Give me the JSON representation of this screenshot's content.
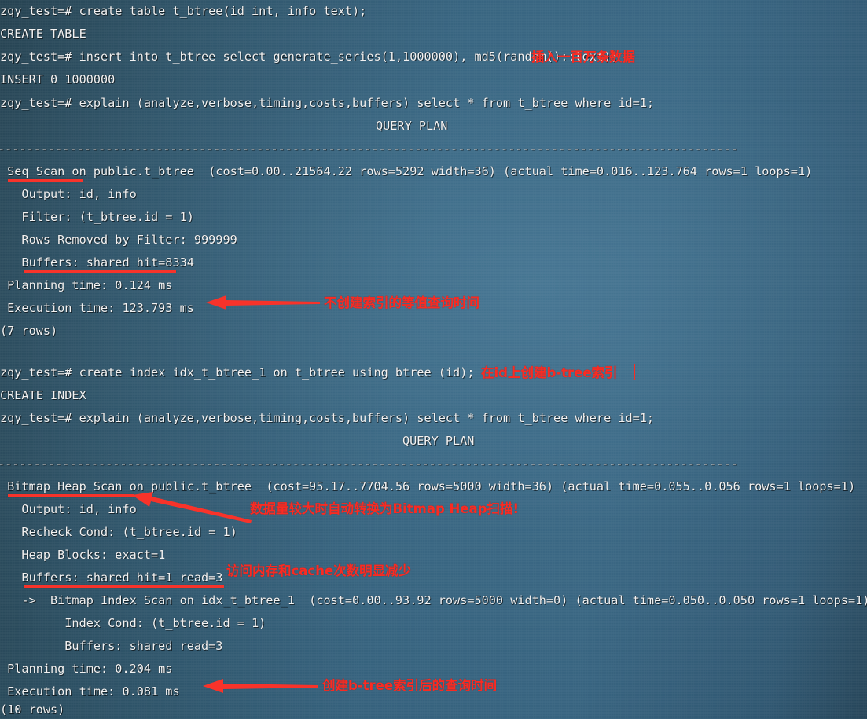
{
  "terminal": {
    "prompt": "zqy_test=#",
    "font_color": "#f2f2f2",
    "background_color": "#35617c",
    "annotation_color": "#fa2b22",
    "lines": [
      {
        "id": "l01",
        "text": "zqy_test=# create table t_btree(id int, info text);"
      },
      {
        "id": "l02",
        "text": "CREATE TABLE"
      },
      {
        "id": "l03",
        "text": "zqy_test=# insert into t_btree select generate_series(1,1000000), md5(random()::text);"
      },
      {
        "id": "l04",
        "text": "INSERT 0 1000000"
      },
      {
        "id": "l05",
        "text": "zqy_test=# explain (analyze,verbose,timing,costs,buffers) select * from t_btree where id=1;"
      },
      {
        "id": "l06",
        "text": "QUERY PLAN"
      },
      {
        "id": "l07",
        "text": "-------------------------------------------------------------------------------------------------------"
      },
      {
        "id": "l08",
        "text": " Seq Scan on public.t_btree  (cost=0.00..21564.22 rows=5292 width=36) (actual time=0.016..123.764 rows=1 loops=1)"
      },
      {
        "id": "l09",
        "text": "   Output: id, info"
      },
      {
        "id": "l10",
        "text": "   Filter: (t_btree.id = 1)"
      },
      {
        "id": "l11",
        "text": "   Rows Removed by Filter: 999999"
      },
      {
        "id": "l12",
        "text": "   Buffers: shared hit=8334"
      },
      {
        "id": "l13",
        "text": " Planning time: 0.124 ms"
      },
      {
        "id": "l14",
        "text": " Execution time: 123.793 ms"
      },
      {
        "id": "l15",
        "text": "(7 rows)"
      },
      {
        "id": "l16",
        "text": "zqy_test=# create index idx_t_btree_1 on t_btree using btree (id);"
      },
      {
        "id": "l17",
        "text": "CREATE INDEX"
      },
      {
        "id": "l18",
        "text": "zqy_test=# explain (analyze,verbose,timing,costs,buffers) select * from t_btree where id=1;"
      },
      {
        "id": "l19",
        "text": "QUERY PLAN"
      },
      {
        "id": "l20",
        "text": "-------------------------------------------------------------------------------------------------------"
      },
      {
        "id": "l21",
        "text": " Bitmap Heap Scan on public.t_btree  (cost=95.17..7704.56 rows=5000 width=36) (actual time=0.055..0.056 rows=1 loops=1)"
      },
      {
        "id": "l22",
        "text": "   Output: id, info"
      },
      {
        "id": "l23",
        "text": "   Recheck Cond: (t_btree.id = 1)"
      },
      {
        "id": "l24",
        "text": "   Heap Blocks: exact=1"
      },
      {
        "id": "l25",
        "text": "   Buffers: shared hit=1 read=3"
      },
      {
        "id": "l26",
        "text": "   ->  Bitmap Index Scan on idx_t_btree_1  (cost=0.00..93.92 rows=5000 width=0) (actual time=0.050..0.050 rows=1 loops=1)"
      },
      {
        "id": "l27",
        "text": "         Index Cond: (t_btree.id = 1)"
      },
      {
        "id": "l28",
        "text": "         Buffers: shared read=3"
      },
      {
        "id": "l29",
        "text": " Planning time: 0.204 ms"
      },
      {
        "id": "l30",
        "text": " Execution time: 0.081 ms"
      },
      {
        "id": "l31",
        "text": "(10 rows)"
      }
    ]
  },
  "annotations": {
    "a1": "插入一百万条数据",
    "a2": "不创建索引的等值查询时间",
    "a3": "在id上创建b-tree索引",
    "a4": "数据量较大时自动转换为Bitmap Heap扫描!",
    "a5": "访问内存和cache次数明显减少",
    "a6": "创建b-tree索引后的查询时间"
  }
}
